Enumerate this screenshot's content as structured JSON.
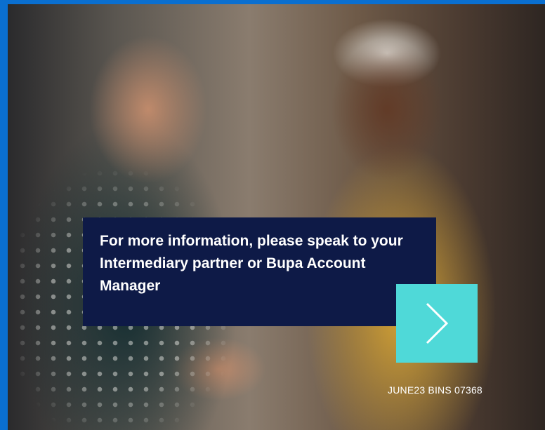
{
  "info_box": {
    "text": "For more information, please speak to your Intermediary partner or Bupa Account Manager"
  },
  "next_button": {
    "icon": "chevron-right-icon"
  },
  "reference_code": "JUNE23 BINS 07368",
  "colors": {
    "border": "#0a6fd0",
    "info_box_bg": "#0e1a47",
    "next_button_bg": "#4fd9d8",
    "text": "#ffffff"
  }
}
